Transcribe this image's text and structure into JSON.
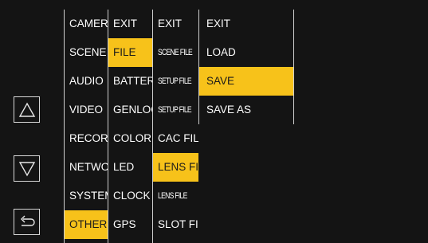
{
  "nav": {
    "up_icon": "triangle-up-icon",
    "down_icon": "triangle-down-icon",
    "back_icon": "return-arrow-icon"
  },
  "menu": {
    "col1": [
      "CAMERA",
      "SCENE",
      "AUDIO",
      "VIDEO",
      "RECORDING",
      "NETWORK",
      "SYSTEM",
      "OTHERS"
    ],
    "col1_selected": 7,
    "col2": [
      "EXIT",
      "FILE",
      "BATTERY",
      "GENLOCK",
      "COLOR",
      "LED",
      "CLOCK",
      "GPS"
    ],
    "col2_selected": 1,
    "col3": [
      "EXIT",
      "SCENE FILE",
      "SETUP FILE",
      "SETUP FILE",
      "CAC FILE",
      "LENS FILE",
      "LENS FILE",
      "SLOT FILE"
    ],
    "col3_selected": 5,
    "col4": [
      "EXIT",
      "LOAD",
      "SAVE",
      "SAVE AS"
    ],
    "col4_selected": 2
  },
  "colors": {
    "highlight": "#f7c21a",
    "background": "#141414",
    "text": "#ffffff"
  }
}
